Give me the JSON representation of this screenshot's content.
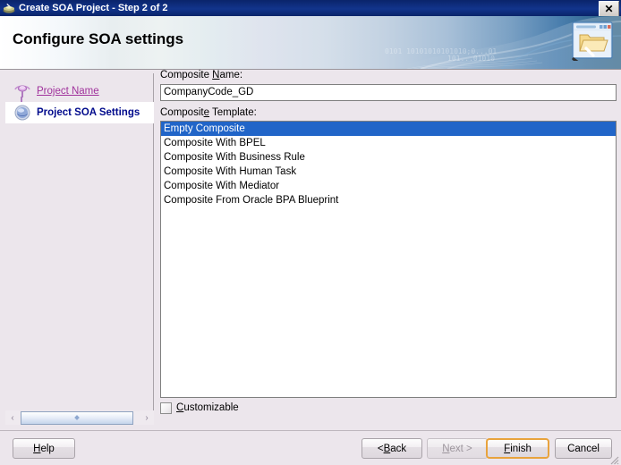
{
  "window": {
    "title": "Create SOA Project - Step 2 of 2",
    "title_icon": "soa-project-icon",
    "close_label": "✕"
  },
  "banner": {
    "heading": "Configure SOA settings",
    "icon": "folder-window-wand-icon",
    "watermark_text": "0101 10101010101010;0...01  101...01010"
  },
  "sidebar": {
    "steps": [
      {
        "label": "Project Name",
        "state": "visited",
        "icon": "node-icon"
      },
      {
        "label": "Project SOA Settings",
        "state": "current",
        "icon": "sphere-icon"
      }
    ],
    "scrollbar": {
      "left_arrow": "‹",
      "right_arrow": "›"
    }
  },
  "form": {
    "composite_name": {
      "label_pre": "Composite ",
      "label_accel": "N",
      "label_post": "ame:",
      "value": "CompanyCode_GD",
      "placeholder": ""
    },
    "composite_template": {
      "label_pre": "Composit",
      "label_accel": "e",
      "label_post": " Template:",
      "options": [
        "Empty Composite",
        "Composite With BPEL",
        "Composite With Business Rule",
        "Composite With Human Task",
        "Composite With Mediator",
        "Composite From Oracle BPA Blueprint"
      ],
      "selected_index": 0
    },
    "customizable": {
      "label_pre": "",
      "label_accel": "C",
      "label_post": "ustomizable",
      "checked": false
    }
  },
  "footer": {
    "help": {
      "pre": "",
      "accel": "H",
      "post": "elp"
    },
    "back": {
      "pre": "< ",
      "accel": "B",
      "post": "ack"
    },
    "next": {
      "pre": "",
      "accel": "N",
      "post": "ext >",
      "disabled": true
    },
    "finish": {
      "pre": "",
      "accel": "F",
      "post": "inish",
      "focused": true
    },
    "cancel": {
      "pre": "",
      "accel": "",
      "post": "Cancel"
    }
  },
  "colors": {
    "titlebar": "#0a246a",
    "dialog_bg": "#ece6ec",
    "selection": "#2165c8",
    "link": "#a0329c",
    "current_step": "#000a8c",
    "focus_ring": "#e8a33d"
  }
}
